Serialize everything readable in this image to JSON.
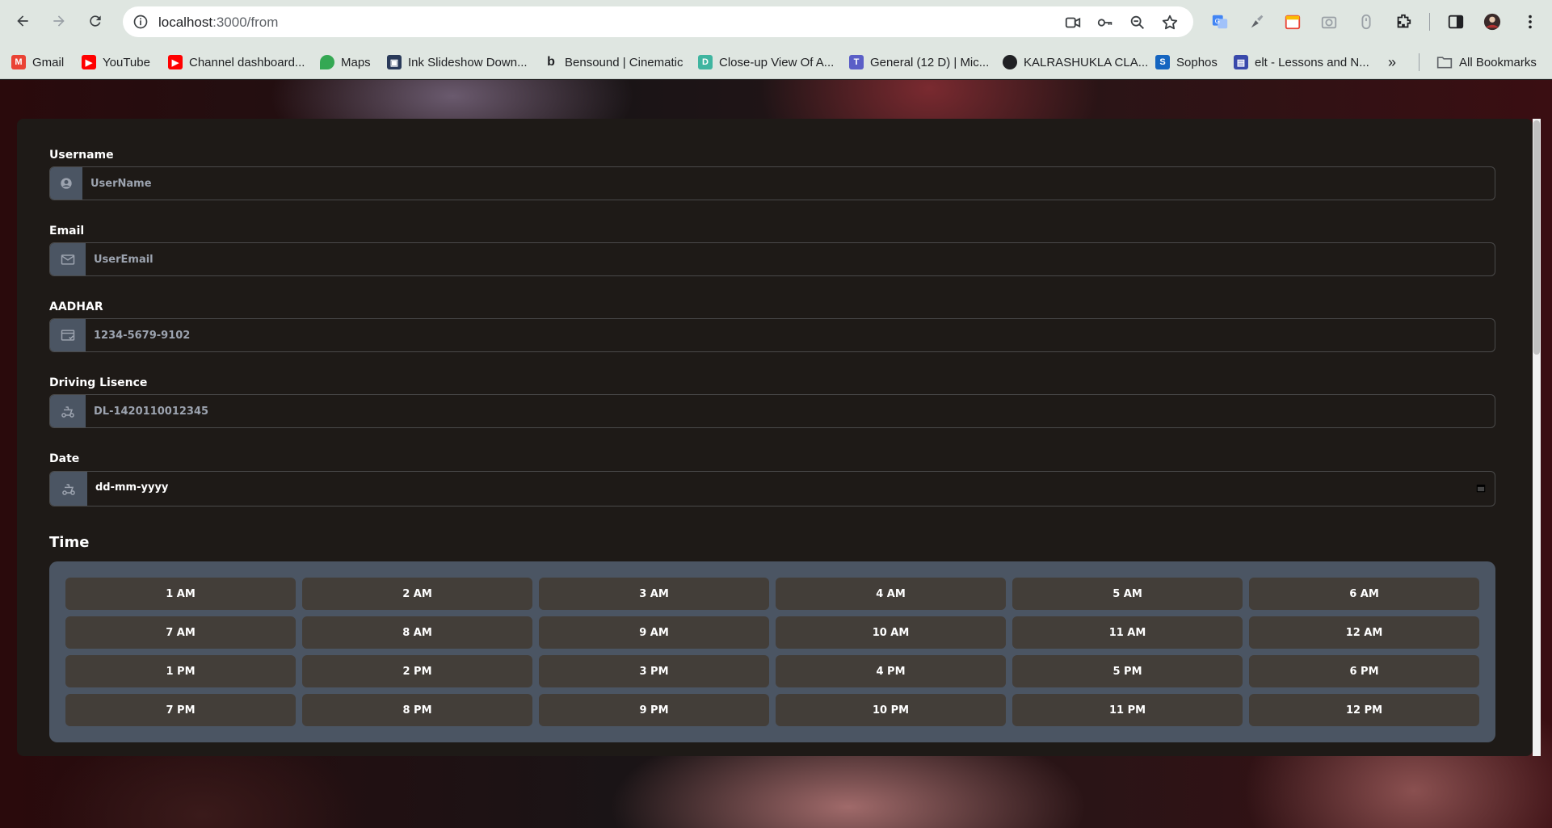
{
  "browser": {
    "url_host": "localhost",
    "url_path": ":3000/from",
    "bookmarks": [
      {
        "label": "Gmail",
        "color": "#ea4335",
        "glyph": "M"
      },
      {
        "label": "YouTube",
        "color": "#ff0000",
        "glyph": "▶"
      },
      {
        "label": "Channel dashboard...",
        "color": "#ff0000",
        "glyph": "▶"
      },
      {
        "label": "Maps",
        "color": "#34a853",
        "glyph": "●"
      },
      {
        "label": "Ink Slideshow Down...",
        "color": "#2a3a5a",
        "glyph": "▣"
      },
      {
        "label": "Bensound | Cinematic",
        "color": "#202124",
        "glyph": "b"
      },
      {
        "label": "Close-up View Of A...",
        "color": "#3fb5a0",
        "glyph": "D"
      },
      {
        "label": "General (12 D) | Mic...",
        "color": "#5b5fc7",
        "glyph": "T"
      },
      {
        "label": "KALRASHUKLA CLA...",
        "color": "#202124",
        "glyph": "●"
      },
      {
        "label": "Sophos",
        "color": "#1565c0",
        "glyph": "S"
      },
      {
        "label": "elt - Lessons and N...",
        "color": "#3949ab",
        "glyph": "▤"
      }
    ],
    "all_bookmarks": "All Bookmarks"
  },
  "form": {
    "username": {
      "label": "Username",
      "placeholder": "UserName"
    },
    "email": {
      "label": "Email",
      "placeholder": "UserEmail"
    },
    "aadhar": {
      "label": "AADHAR",
      "placeholder": "1234-5679-9102"
    },
    "license": {
      "label": "Driving Lisence",
      "placeholder": "DL-1420110012345"
    },
    "date": {
      "label": "Date",
      "value": "dd-mm-yyyy"
    },
    "time": {
      "title": "Time",
      "slots": [
        "1 AM",
        "2 AM",
        "3 AM",
        "4 AM",
        "5 AM",
        "6 AM",
        "7 AM",
        "8 AM",
        "9 AM",
        "10 AM",
        "11 AM",
        "12 AM",
        "1 PM",
        "2 PM",
        "3 PM",
        "4 PM",
        "5 PM",
        "6 PM",
        "7 PM",
        "8 PM",
        "9 PM",
        "10 PM",
        "11 PM",
        "12 PM"
      ]
    }
  }
}
